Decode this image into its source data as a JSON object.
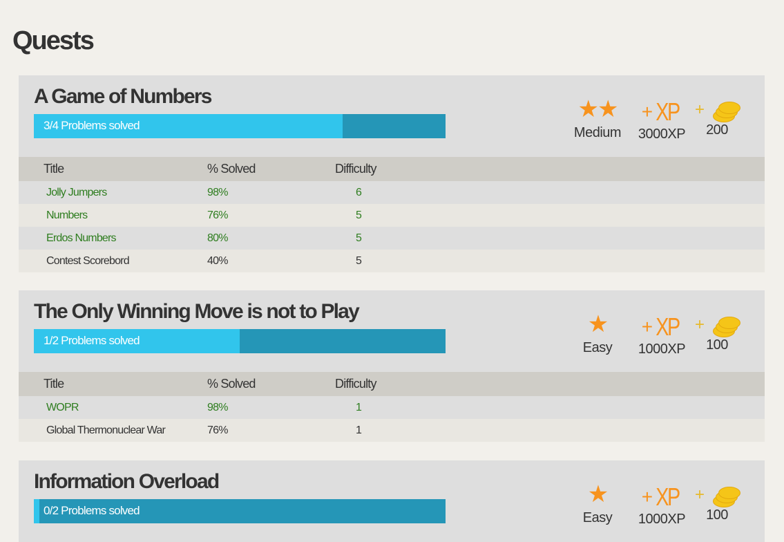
{
  "page": {
    "title": "Quests"
  },
  "table_headers": {
    "title": "Title",
    "solved": "% Solved",
    "difficulty": "Difficulty"
  },
  "colors": {
    "solved_text": "#2e7d1f",
    "progress_fill": "#31c5ec",
    "progress_track": "#2596b7",
    "star": "#f7931e",
    "coin": "#f5c518"
  },
  "quests": [
    {
      "title": "A Game of Numbers",
      "progress_label": "3/4 Problems solved",
      "progress_fraction": 0.75,
      "stars": "★★",
      "difficulty_label": "Medium",
      "xp_icon": "+XP",
      "xp_label": "3000XP",
      "coin_icon": "coins-icon",
      "coins_label": "200",
      "problems": [
        {
          "title": "Jolly Jumpers",
          "solved": "98%",
          "difficulty": "6",
          "done": true
        },
        {
          "title": "Numbers",
          "solved": "76%",
          "difficulty": "5",
          "done": true
        },
        {
          "title": "Erdos Numbers",
          "solved": "80%",
          "difficulty": "5",
          "done": true
        },
        {
          "title": "Contest Scorebord",
          "solved": "40%",
          "difficulty": "5",
          "done": false
        }
      ]
    },
    {
      "title": "The Only Winning Move is not to Play",
      "progress_label": "1/2 Problems solved",
      "progress_fraction": 0.5,
      "stars": "★",
      "difficulty_label": "Easy",
      "xp_icon": "+XP",
      "xp_label": "1000XP",
      "coin_icon": "coins-icon",
      "coins_label": "100",
      "problems": [
        {
          "title": "WOPR",
          "solved": "98%",
          "difficulty": "1",
          "done": true
        },
        {
          "title": "Global Thermonuclear War",
          "solved": "76%",
          "difficulty": "1",
          "done": false
        }
      ]
    },
    {
      "title": "Information Overload",
      "progress_label": "0/2 Problems solved",
      "progress_fraction": 0.0,
      "stars": "★",
      "difficulty_label": "Easy",
      "xp_icon": "+XP",
      "xp_label": "1000XP",
      "coin_icon": "coins-icon",
      "coins_label": "100",
      "problems": []
    }
  ]
}
